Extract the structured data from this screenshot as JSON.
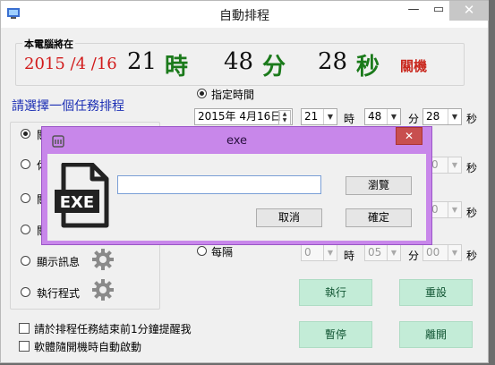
{
  "window": {
    "title": "自動排程",
    "minimize": "—",
    "maximize": "▭",
    "close": "✕"
  },
  "clock": {
    "group_label": "本電腦將在",
    "date": "2015 /4 /16",
    "hour": "21",
    "hour_unit": "時",
    "minute": "48",
    "minute_unit": "分",
    "second": "28",
    "second_unit": "秒",
    "action": "關機"
  },
  "task_heading": "請選擇一個任務排程",
  "tasks": [
    {
      "label": "關",
      "checked": true
    },
    {
      "label": "休",
      "checked": false
    },
    {
      "label": "關",
      "checked": false
    },
    {
      "label": "關",
      "checked": false
    },
    {
      "label": "顯示訊息",
      "checked": false
    },
    {
      "label": "執行程式",
      "checked": false
    }
  ],
  "schedule": {
    "specified_label": "指定時間",
    "date_value": "2015年  4月16日",
    "hour": "21",
    "minute": "48",
    "second": "28",
    "unit_hour": "時",
    "unit_minute": "分",
    "unit_second": "秒",
    "every_label": "每隔",
    "disabled_second_1": "0",
    "disabled_second_2": "0",
    "every_hour": "0",
    "every_minute": "05",
    "every_second": "00"
  },
  "buttons": {
    "run": "執行",
    "reset": "重設",
    "pause": "暫停",
    "exit": "離開"
  },
  "options": {
    "remind": "請於排程任務結束前1分鐘提醒我",
    "autostart": "軟體隨開機時自動啟動"
  },
  "dialog": {
    "title": "exe",
    "close": "✕",
    "path_value": "",
    "browse": "瀏覽",
    "cancel": "取消",
    "ok": "確定",
    "icon_text": "EXE"
  },
  "colors": {
    "green_button": "#c3ecd7",
    "dialog_frame": "#c887ea",
    "red": "#d11a1a",
    "green": "#1b7a1b",
    "blue": "#1c2fb4"
  }
}
